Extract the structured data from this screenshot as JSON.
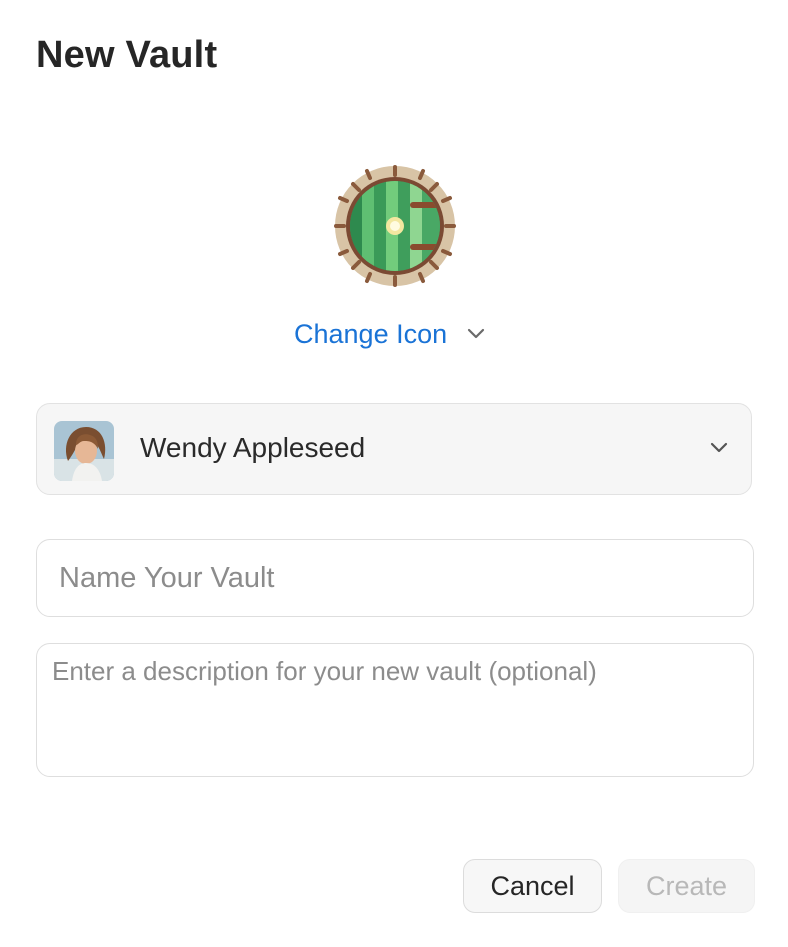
{
  "dialog": {
    "title": "New Vault"
  },
  "icon_picker": {
    "icon": "hobbit-door-icon",
    "change_label": "Change Icon"
  },
  "owner": {
    "name": "Wendy Appleseed",
    "avatar": "user-avatar"
  },
  "fields": {
    "name_placeholder": "Name Your Vault",
    "name_value": "",
    "description_placeholder": "Enter a description for your new vault (optional)",
    "description_value": ""
  },
  "actions": {
    "cancel_label": "Cancel",
    "create_label": "Create",
    "create_enabled": false
  },
  "colors": {
    "accent": "#1a73d6",
    "disabled_text": "#b8b8b8"
  }
}
